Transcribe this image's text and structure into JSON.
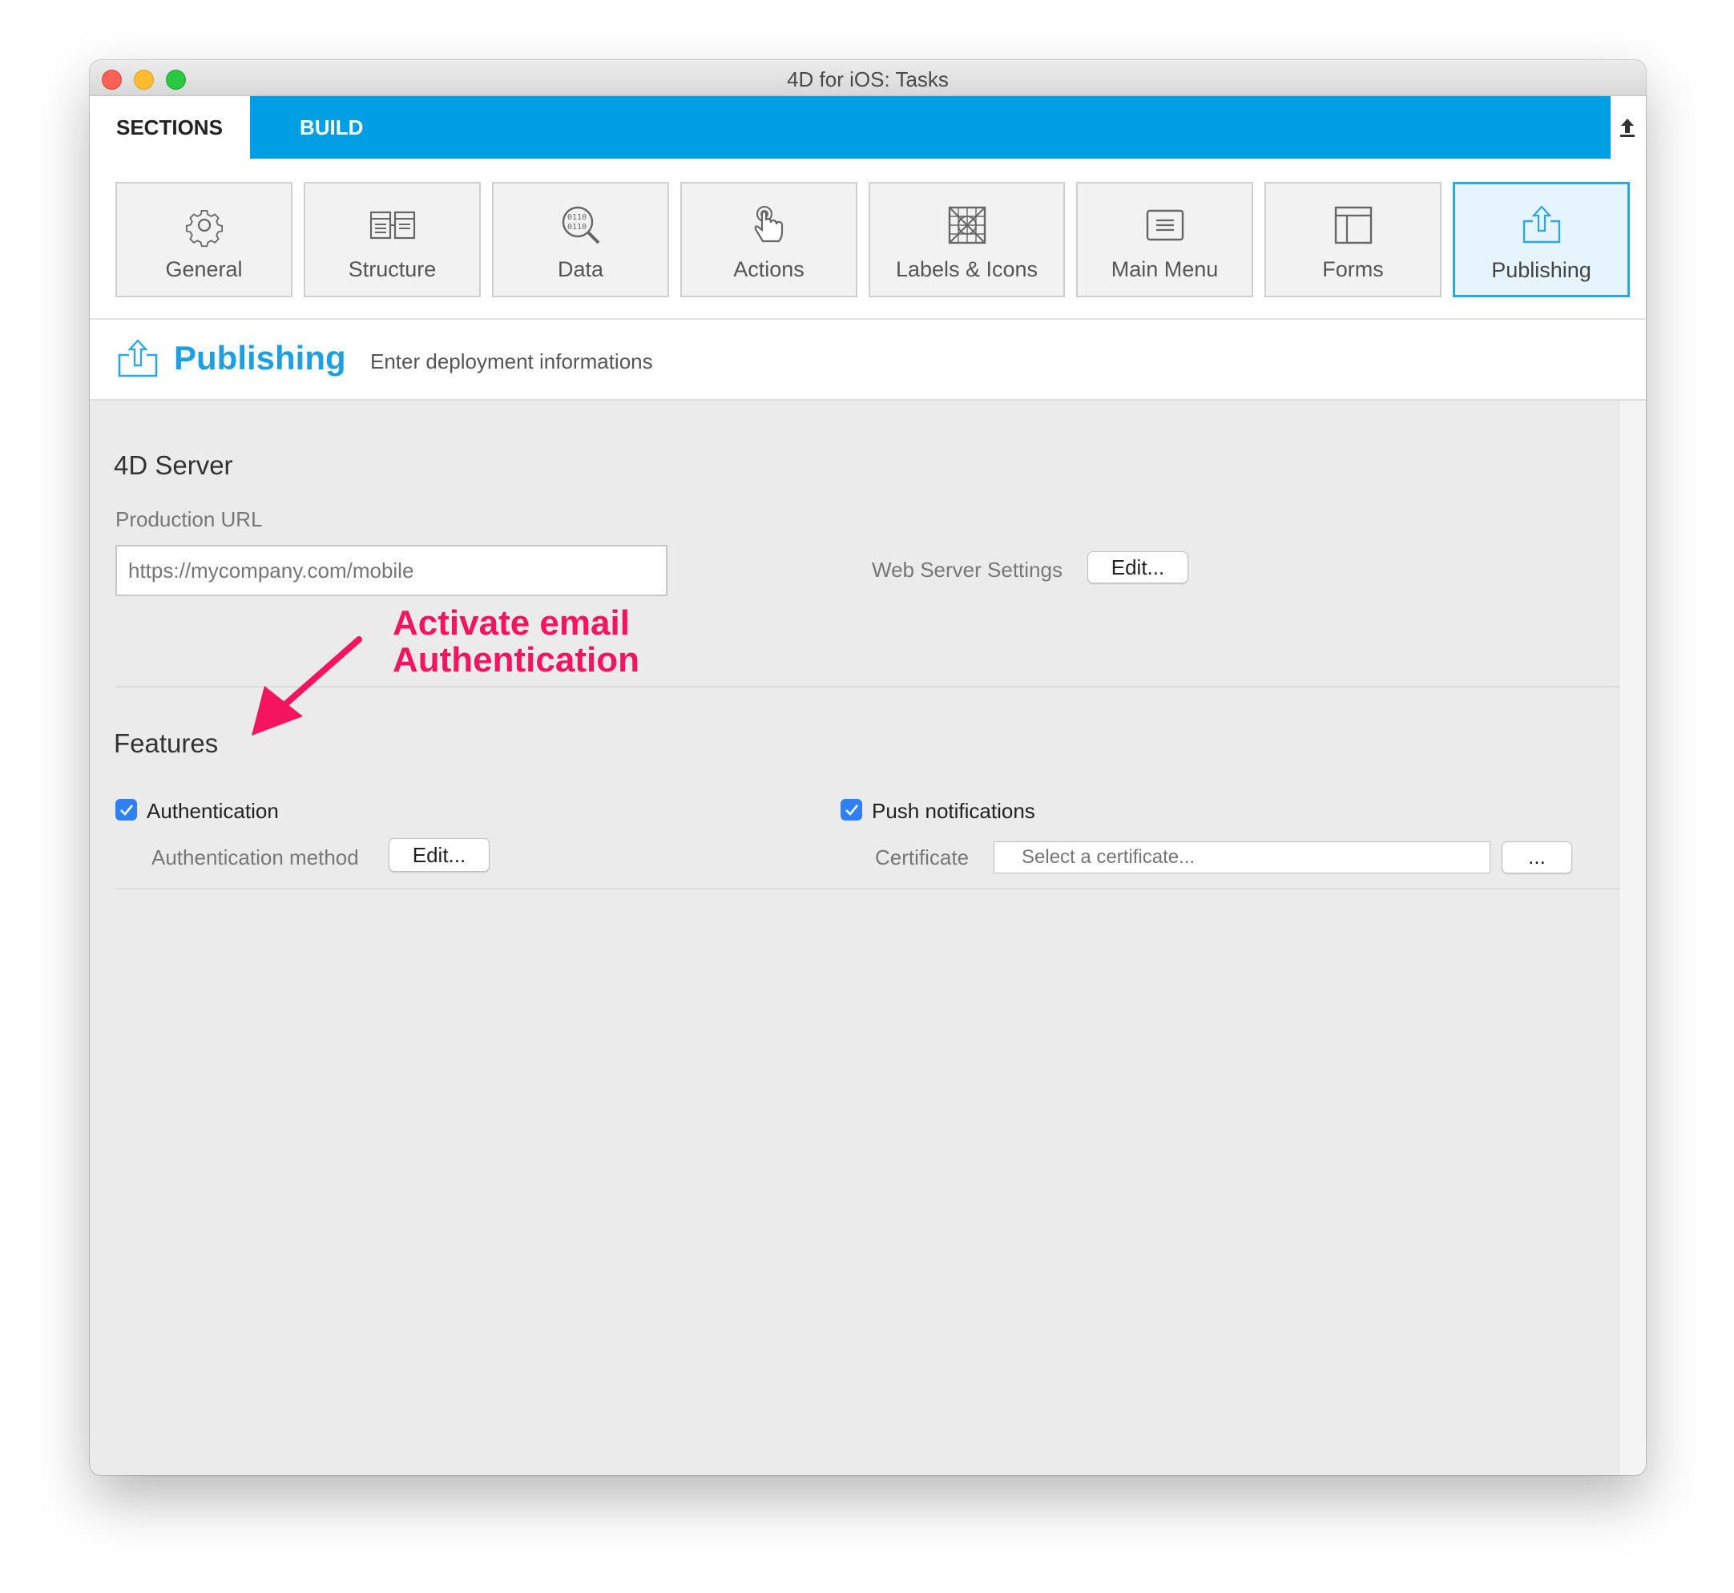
{
  "window": {
    "title": "4D for iOS: Tasks"
  },
  "tabs": {
    "sections_label": "SECTIONS",
    "build_label": "BUILD"
  },
  "sections": {
    "items": [
      {
        "label": "General",
        "icon": "gear-icon"
      },
      {
        "label": "Structure",
        "icon": "structure-icon"
      },
      {
        "label": "Data",
        "icon": "data-magnifier-icon"
      },
      {
        "label": "Actions",
        "icon": "hand-pointer-icon"
      },
      {
        "label": "Labels & Icons",
        "icon": "labels-icons-grid-icon"
      },
      {
        "label": "Main Menu",
        "icon": "main-menu-icon"
      },
      {
        "label": "Forms",
        "icon": "forms-layout-icon"
      },
      {
        "label": "Publishing",
        "icon": "publishing-upload-icon"
      }
    ],
    "active": "Publishing"
  },
  "header": {
    "title": "Publishing",
    "subtitle": "Enter deployment informations"
  },
  "server": {
    "title": "4D Server",
    "production_url_label": "Production URL",
    "production_url_placeholder": "https://mycompany.com/mobile",
    "web_server_label": "Web Server Settings",
    "web_server_edit": "Edit..."
  },
  "features": {
    "title": "Features",
    "authentication_label": "Authentication",
    "authentication_checked": true,
    "auth_method_label": "Authentication method",
    "auth_method_edit": "Edit...",
    "push_label": "Push notifications",
    "push_checked": true,
    "certificate_label": "Certificate",
    "certificate_placeholder": "Select a certificate...",
    "certificate_browse": "..."
  },
  "annotation": {
    "line1": "Activate email",
    "line2": "Authentication",
    "color": "#f5145f"
  },
  "colors": {
    "accent": "#009fe3",
    "header_title": "#1ea0e0",
    "checkbox": "#2f7ff5"
  }
}
